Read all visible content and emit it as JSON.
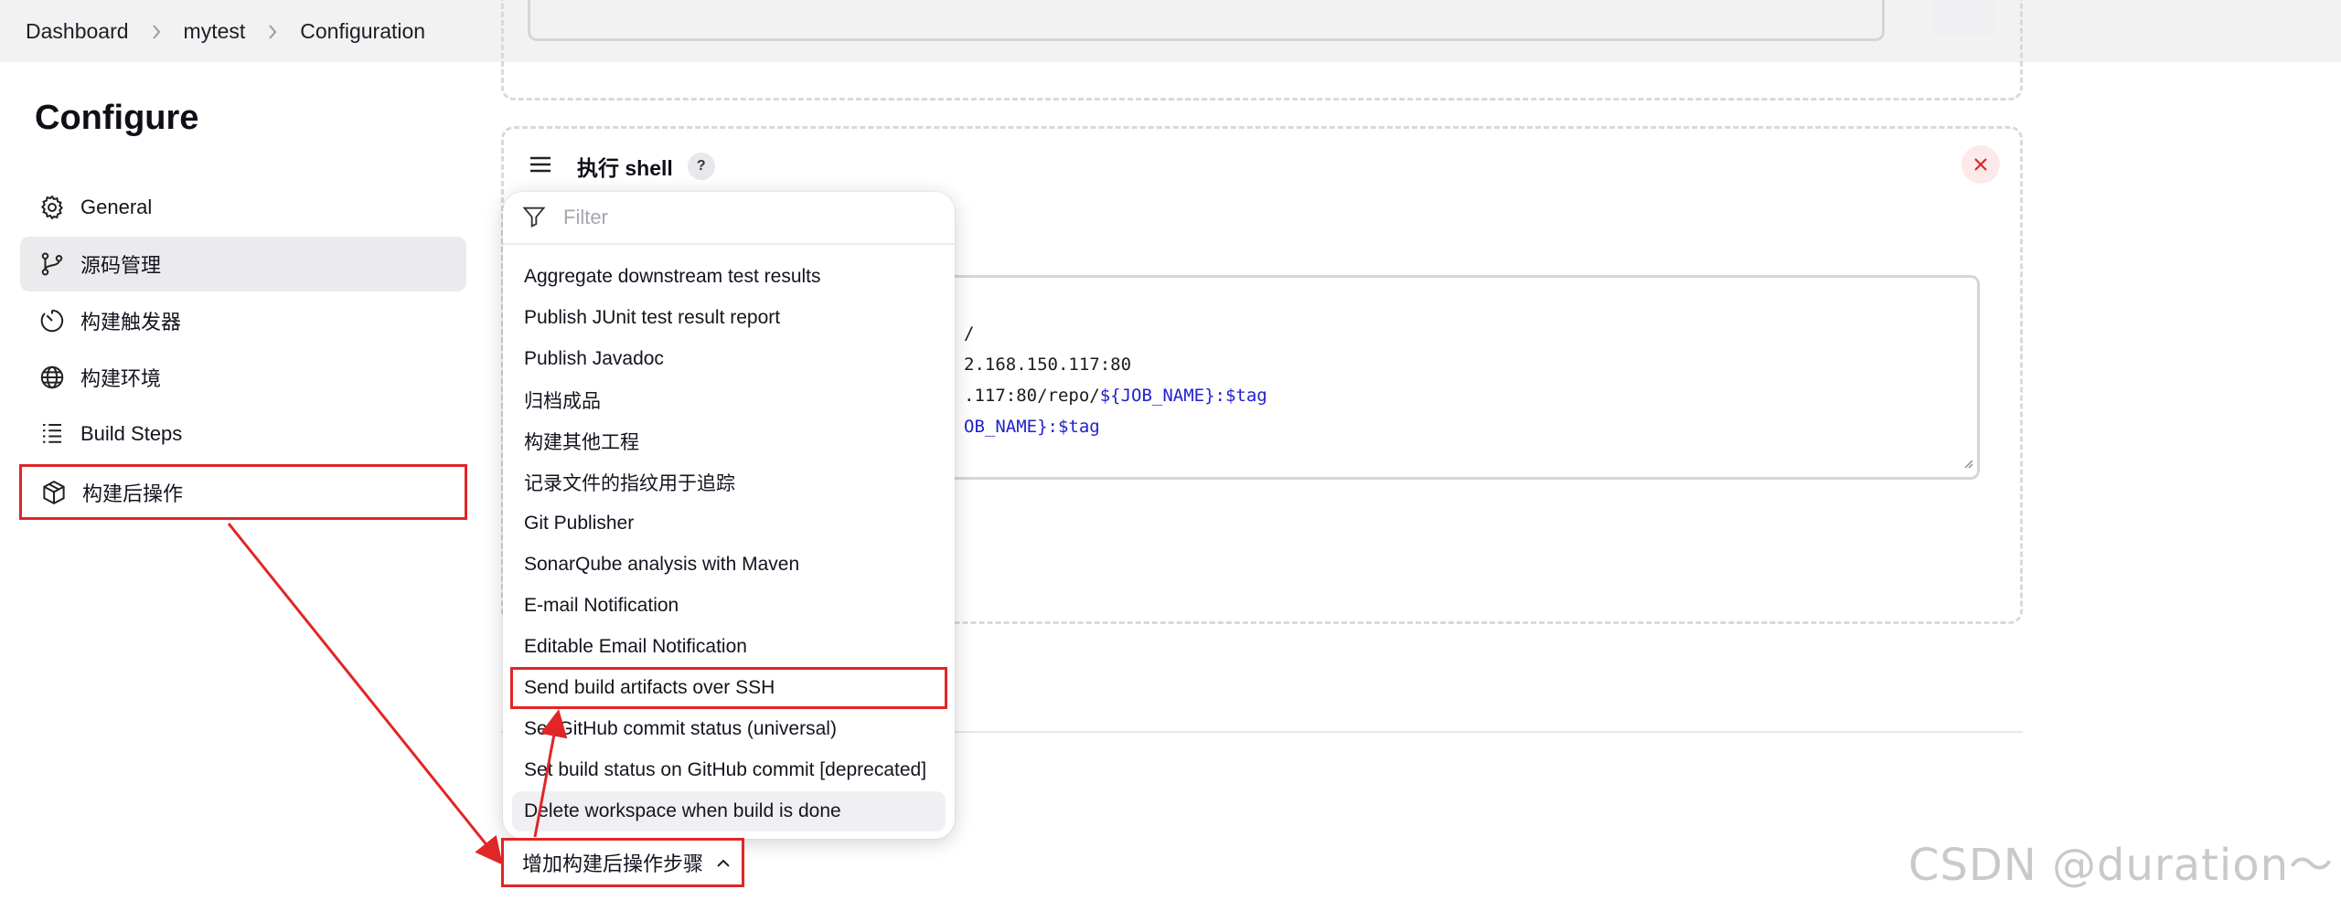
{
  "breadcrumb": [
    "Dashboard",
    "mytest",
    "Configuration"
  ],
  "page_title": "Configure",
  "sidebar": {
    "items": [
      {
        "label": "General",
        "icon": "gear-icon"
      },
      {
        "label": "源码管理",
        "icon": "branch-icon"
      },
      {
        "label": "构建触发器",
        "icon": "timer-icon"
      },
      {
        "label": "构建环境",
        "icon": "globe-icon"
      },
      {
        "label": "Build Steps",
        "icon": "list-icon"
      },
      {
        "label": "构建后操作",
        "icon": "package-icon"
      }
    ],
    "active_index": 1,
    "highlight_index": 5
  },
  "shell_step": {
    "title": "执行 shell",
    "help": "?",
    "code_lines": [
      {
        "text": "/",
        "var": ""
      },
      {
        "text": "2.168.150.117:80",
        "var": ""
      },
      {
        "text": ".117:80/repo/",
        "var": "${JOB_NAME}:$tag"
      },
      {
        "text": "",
        "var": "OB_NAME}:$tag"
      }
    ]
  },
  "dropdown": {
    "filter_placeholder": "Filter",
    "items": [
      "Aggregate downstream test results",
      "Publish JUnit test result report",
      "Publish Javadoc",
      "归档成品",
      "构建其他工程",
      "记录文件的指纹用于追踪",
      "Git Publisher",
      "SonarQube analysis with Maven",
      "E-mail Notification",
      "Editable Email Notification",
      "Send build artifacts over SSH",
      "Set GitHub commit status (universal)",
      "Set build status on GitHub commit [deprecated]",
      "Delete workspace when build is done"
    ],
    "highlight_index": 10,
    "hover_index": 13
  },
  "add_step_label": "增加构建后操作步骤",
  "watermark": "CSDN @duration～",
  "colors": {
    "annotation": "#e02626",
    "accent_text": "#2222cc"
  }
}
